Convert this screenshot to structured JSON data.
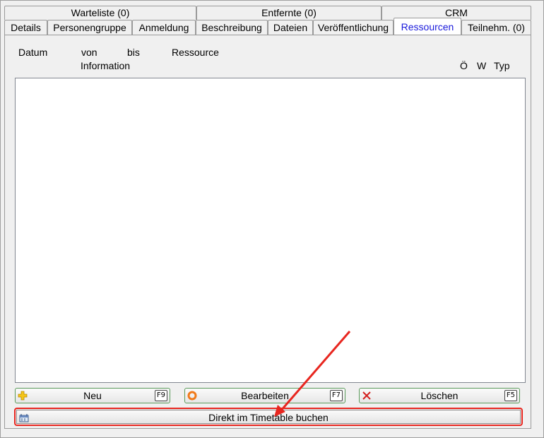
{
  "tabs_row1": [
    "Warteliste (0)",
    "Entfernte (0)",
    "CRM"
  ],
  "tabs_row2": [
    "Details",
    "Personengruppe",
    "Anmeldung",
    "Beschreibung",
    "Dateien",
    "Veröffentlichung",
    "Ressourcen",
    "Teilnehm. (0)"
  ],
  "active_tab": "Ressourcen",
  "columns": {
    "datum": "Datum",
    "von": "von",
    "bis": "bis",
    "ressource": "Ressource",
    "information": "Information",
    "oe": "Ö",
    "w": "W",
    "typ": "Typ"
  },
  "buttons": {
    "neu": {
      "label": "Neu",
      "key": "F9",
      "icon": "plus-icon"
    },
    "bearbeiten": {
      "label": "Bearbeiten",
      "key": "F7",
      "icon": "edit-ring-icon"
    },
    "loeschen": {
      "label": "Löschen",
      "key": "F5",
      "icon": "delete-x-icon"
    },
    "timetable": {
      "label": "Direkt im Timetable buchen",
      "icon": "timetable-icon"
    }
  },
  "colors": {
    "active_tab_text": "#1a1adb",
    "highlight": "#e8261f",
    "plus_icon": "#f5c518",
    "edit_icon": "#f07a1a",
    "delete_icon": "#d42020"
  }
}
